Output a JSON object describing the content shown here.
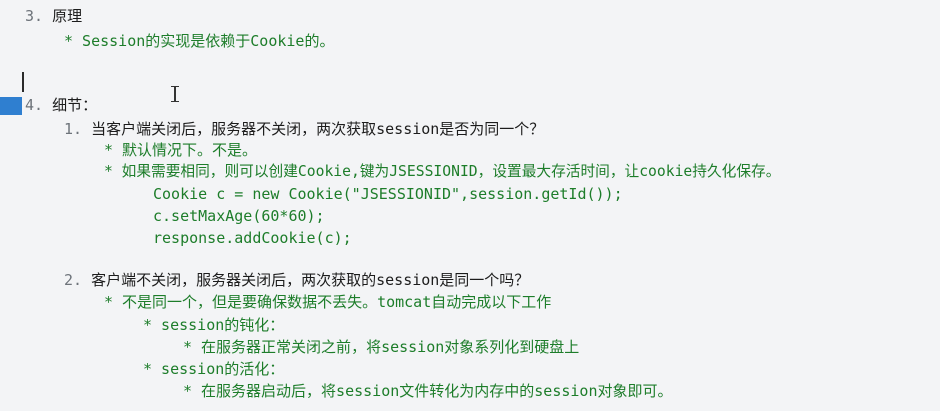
{
  "doc": {
    "s3_num": "3.",
    "s3_title": "原理",
    "s3_bullet": "* Session的实现是依赖于Cookie的。",
    "s4_num": "4.",
    "s4_title": "细节：",
    "q1_num": "1.",
    "q1_text": "当客户端关闭后，服务器不关闭，两次获取session是否为同一个？",
    "q1_a1": "* 默认情况下。不是。",
    "q1_a2": "* 如果需要相同，则可以创建Cookie,键为JSESSIONID，设置最大存活时间，让cookie持久化保存。",
    "code1": "Cookie c = new Cookie(\"JSESSIONID\",session.getId());",
    "code2": "c.setMaxAge(60*60);",
    "code3": "response.addCookie(c);",
    "q2_num": "2.",
    "q2_text": "客户端不关闭，服务器关闭后，两次获取的session是同一个吗？",
    "q2_a1": "* 不是同一个，但是要确保数据不丢失。tomcat自动完成以下工作",
    "q2_b1": "* session的钝化：",
    "q2_b1_detail": "* 在服务器正常关闭之前，将session对象系列化到硬盘上",
    "q2_b2": "* session的活化：",
    "q2_b2_detail": "* 在服务器启动后，将session文件转化为内存中的session对象即可。"
  },
  "colors": {
    "background": "#f3f4f6",
    "text": "#1c1c1c",
    "green": "#1d7d2a",
    "number": "#6d737a",
    "gutter_marker": "#2f7fd0"
  },
  "icons": [
    "text-cursor-icon"
  ]
}
